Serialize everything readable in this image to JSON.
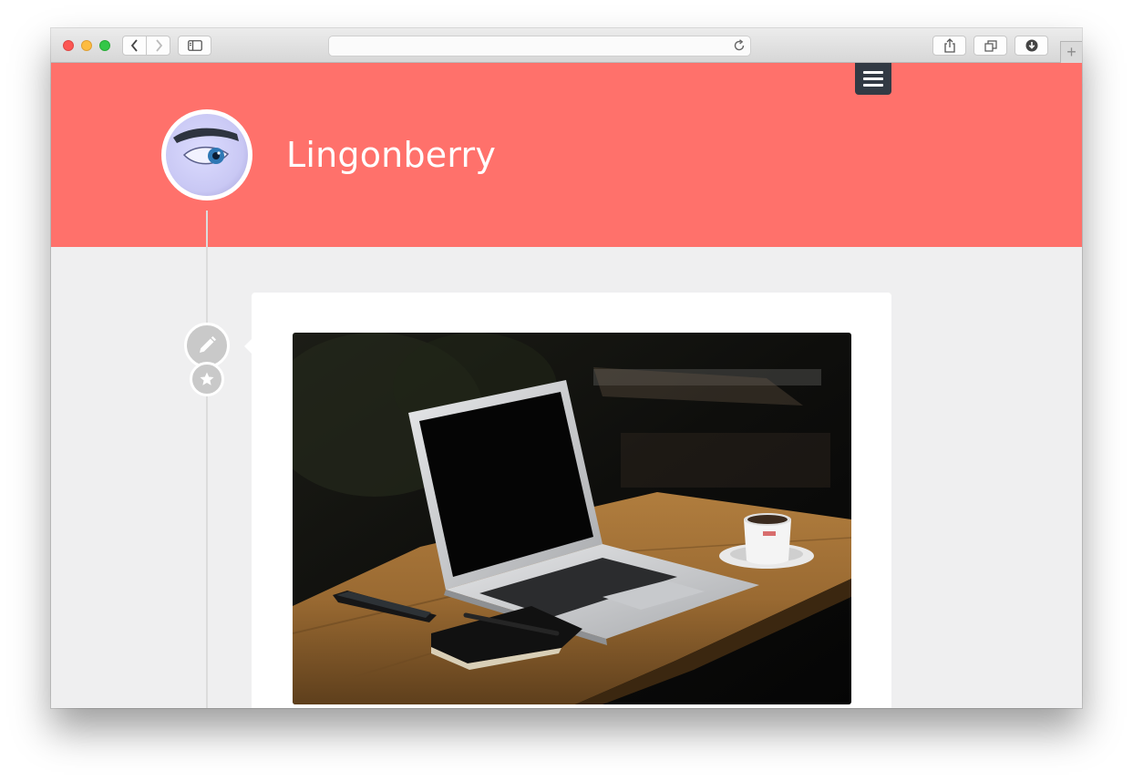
{
  "site": {
    "title": "Lingonberry"
  },
  "browser": {
    "address_text": ""
  },
  "icons": {
    "back": "chevron-left-icon",
    "forward": "chevron-right-icon",
    "sidebar": "sidebar-icon",
    "reload": "reload-icon",
    "share": "share-icon",
    "tabs": "tabs-icon",
    "downloads": "download-icon",
    "menu": "hamburger-menu-icon",
    "post_format": "pencil-icon",
    "sticky": "star-icon"
  },
  "colors": {
    "header": "#ff716b",
    "menu_button": "#323a44",
    "page_background": "#efeff0",
    "post_icon": "#c9c9c9"
  }
}
